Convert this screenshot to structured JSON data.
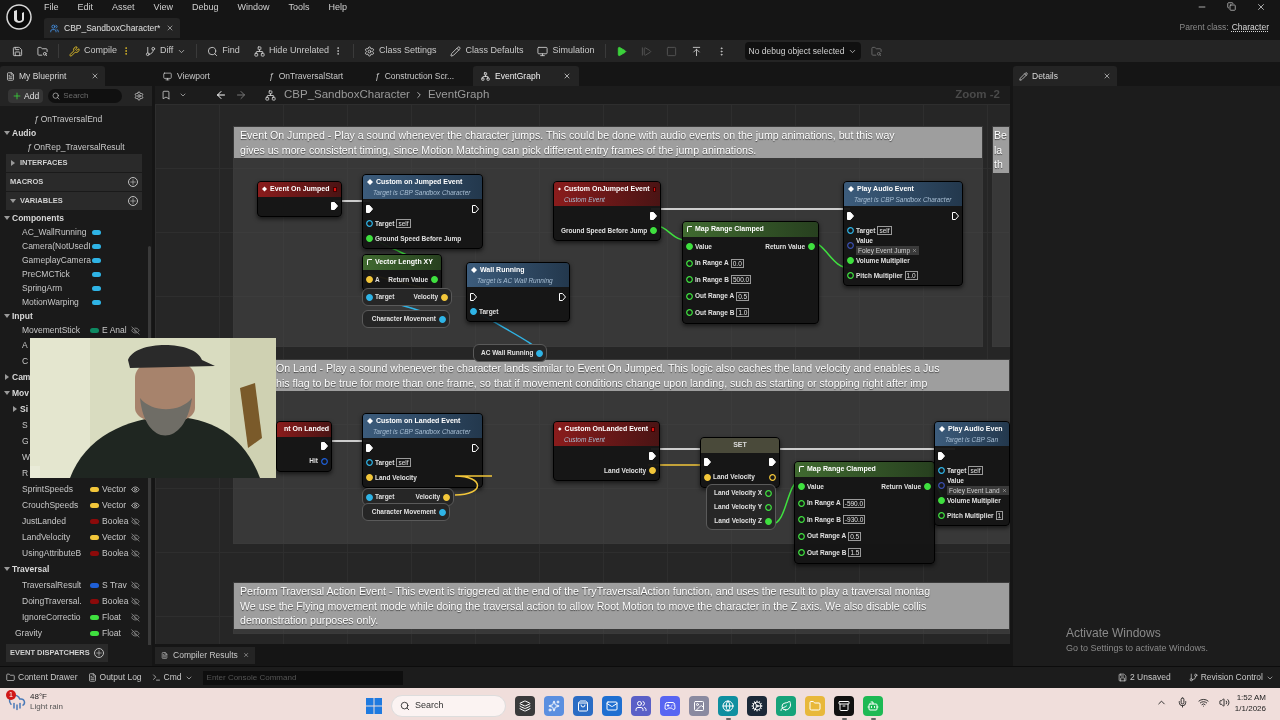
{
  "menu": [
    "File",
    "Edit",
    "Asset",
    "View",
    "Debug",
    "Window",
    "Tools",
    "Help"
  ],
  "document_tab": {
    "title": "CBP_SandboxCharacter*"
  },
  "parent_class": {
    "label": "Parent class:",
    "value": "Character"
  },
  "toolbar": [
    {
      "kind": "save",
      "disabled": false
    },
    {
      "kind": "browse",
      "disabled": false
    },
    {
      "kind": "compile",
      "label": "Compile",
      "options": true,
      "disabled": false
    },
    {
      "kind": "diff",
      "label": "Diff",
      "dropdown": true,
      "disabled": false
    },
    {
      "kind": "find",
      "label": "Find",
      "disabled": false
    },
    {
      "kind": "hide",
      "label": "Hide Unrelated",
      "options": true,
      "disabled": false
    },
    {
      "kind": "class_settings",
      "label": "Class Settings",
      "disabled": false
    },
    {
      "kind": "class_defaults",
      "label": "Class Defaults",
      "disabled": false
    },
    {
      "kind": "simulation",
      "label": "Simulation",
      "disabled": false
    },
    {
      "kind": "play",
      "disabled": false
    },
    {
      "kind": "advance",
      "disabled": true
    },
    {
      "kind": "stop",
      "disabled": true
    },
    {
      "kind": "eject",
      "disabled": false
    },
    {
      "kind": "more",
      "disabled": false
    }
  ],
  "debug_filter": {
    "value": "No debug object selected"
  },
  "my_blueprint": {
    "tab": "My Blueprint",
    "add": "Add",
    "search_placeholder": "Search",
    "tree": [
      {
        "kind": "function",
        "glyph": "ƒ",
        "name": "OnTraversalEnd"
      },
      {
        "kind": "category",
        "name": "Audio",
        "expanded": true,
        "children": [
          {
            "kind": "function",
            "glyph": "ƒ",
            "name": "OnRep_TraversalResult"
          }
        ]
      },
      {
        "kind": "section",
        "name": "INTERFACES",
        "expanded": false,
        "addable": false
      },
      {
        "kind": "section",
        "name": "MACROS",
        "addable": true
      },
      {
        "kind": "section",
        "name": "VARIABLES",
        "expanded": true,
        "addable": true,
        "children": [
          {
            "kind": "category",
            "name": "Components",
            "expanded": true,
            "children": [
              {
                "kind": "variable",
                "name": "AC_WallRunning",
                "color": "#2fb4e6"
              },
              {
                "kind": "variable",
                "name": "Camera(NotUsedI",
                "color": "#2fb4e6"
              },
              {
                "kind": "variable",
                "name": "GameplayCamera",
                "color": "#2fb4e6"
              },
              {
                "kind": "variable",
                "name": "PreCMCTick",
                "color": "#2fb4e6"
              },
              {
                "kind": "variable",
                "name": "SpringArm",
                "color": "#2fb4e6"
              },
              {
                "kind": "variable",
                "name": "MotionWarping",
                "color": "#2fb4e6"
              }
            ]
          },
          {
            "kind": "category",
            "name": "Input",
            "expanded": true,
            "children": [
              {
                "kind": "variable",
                "name": "MovementStick",
                "type": "E Anal",
                "color": "#0e8a62",
                "public": false
              },
              {
                "kind": "variable",
                "name": "A"
              },
              {
                "kind": "variable",
                "name": "C"
              }
            ]
          },
          {
            "kind": "category",
            "name": "Cam",
            "expanded": false
          },
          {
            "kind": "category",
            "name": "Mov",
            "expanded": true,
            "children": [
              {
                "kind": "category",
                "name": "Si",
                "expanded": false
              },
              {
                "kind": "variable",
                "name": "S"
              },
              {
                "kind": "variable",
                "name": "G"
              },
              {
                "kind": "variable",
                "name": "W"
              },
              {
                "kind": "variable",
                "name": "R"
              },
              {
                "kind": "variable",
                "name": "SprintSpeeds",
                "type": "Vector",
                "color": "#f2c63a",
                "public": true
              },
              {
                "kind": "variable",
                "name": "CrouchSpeeds",
                "type": "Vector",
                "color": "#f2c63a",
                "public": true
              },
              {
                "kind": "variable",
                "name": "JustLanded",
                "type": "Boolea",
                "color": "#8c0a0a",
                "public": false
              },
              {
                "kind": "variable",
                "name": "LandVelocity",
                "type": "Vector",
                "color": "#f2c63a",
                "public": false
              },
              {
                "kind": "variable",
                "name": "UsingAttributeB",
                "type": "Boolea",
                "color": "#8c0a0a",
                "public": false
              }
            ]
          },
          {
            "kind": "category",
            "name": "Traversal",
            "expanded": true,
            "children": [
              {
                "kind": "variable",
                "name": "TraversalResult",
                "type": "S Trav",
                "color": "#1f5fd6",
                "public": false
              },
              {
                "kind": "variable",
                "name": "DoingTraversal.",
                "type": "Boolea",
                "color": "#8c0a0a",
                "public": false
              },
              {
                "kind": "variable",
                "name": "IgnoreCorrectio",
                "type": "Float",
                "color": "#3fe03f",
                "public": false
              }
            ]
          },
          {
            "kind": "variable",
            "name": "Gravity",
            "type": "Float",
            "color": "#3fe03f",
            "public": false
          }
        ]
      }
    ],
    "footer": {
      "kind": "section",
      "name": "EVENT DISPATCHERS",
      "addable": true
    }
  },
  "editor_tabs": [
    {
      "kind": "viewport",
      "label": "Viewport",
      "selected": false
    },
    {
      "kind": "function",
      "glyph": "ƒ",
      "label": "OnTraversalStart",
      "selected": false
    },
    {
      "kind": "function",
      "glyph": "ƒ",
      "label": "Construction Scr...",
      "selected": false
    },
    {
      "kind": "graph",
      "label": "EventGraph",
      "selected": true
    }
  ],
  "graph": {
    "breadcrumb": [
      "CBP_SandboxCharacter",
      "EventGraph"
    ],
    "zoom": "Zoom -2",
    "comments": [
      {
        "lines": [
          "Event On Jumped - Play a sound whenever the character jumps. This could be done with audio events on the jump animations, but this way",
          "gives us more consistent timing, since Motion Matching can pick different entry frames of the jump animations."
        ]
      },
      {
        "lines": [
          "On Land - Play a sound whenever the character lands similar to Event On Jumped. This logic also caches the land velocity and enables a Jus",
          "his flag to be true for more than one frame, so that if movement conditions change upon landing, such as starting or stopping right after imp"
        ]
      },
      {
        "lines": [
          "Perform Traversal Action Event - This event is triggered at the end of the TryTraversalAction function, and uses the result to play a traversal montag",
          "We use the Flying movement mode while doing the traversal action to allow Root Motion to move the character in the Z axis. We also disable collis",
          "demonstration purposes only."
        ]
      },
      {
        "lines": [
          "Be",
          "la",
          "th"
        ]
      }
    ],
    "nodes": [
      {
        "kind": "event",
        "title": "Event On Jumped",
        "outputs": [
          {
            "kind": "exec",
            "linked": true
          }
        ]
      },
      {
        "kind": "function",
        "title": "Custom on Jumped Event",
        "subtitle": "Target is CBP Sandbox Character",
        "inputs": [
          {
            "kind": "exec",
            "linked": true
          },
          {
            "kind": "object",
            "label": "Target",
            "value": "self",
            "linked": false
          },
          {
            "kind": "float",
            "label": "Ground Speed Before Jump",
            "linked": true
          }
        ],
        "outputs": [
          {
            "kind": "exec",
            "linked": false
          }
        ]
      },
      {
        "kind": "pure",
        "title": "Vector Length XY",
        "inputs": [
          {
            "kind": "vector",
            "label": "A",
            "linked": true
          }
        ],
        "outputs": [
          {
            "kind": "float",
            "label": "Return Value",
            "linked": true
          }
        ]
      },
      {
        "kind": "getter",
        "inputs": [
          {
            "kind": "object",
            "label": "Target",
            "linked": true
          }
        ],
        "outputs": [
          {
            "kind": "vector",
            "label": "Velocity",
            "linked": true
          }
        ]
      },
      {
        "kind": "getter",
        "outputs": [
          {
            "kind": "object",
            "label": "Character Movement",
            "linked": true
          }
        ]
      },
      {
        "kind": "function",
        "title": "Wall Running",
        "subtitle": "Target is AC Wall Running",
        "inputs": [
          {
            "kind": "exec",
            "linked": false
          },
          {
            "kind": "object",
            "label": "Target",
            "linked": true
          }
        ],
        "outputs": [
          {
            "kind": "exec",
            "linked": false
          }
        ]
      },
      {
        "kind": "getter",
        "outputs": [
          {
            "kind": "object",
            "label": "AC Wall Running",
            "linked": true
          }
        ]
      },
      {
        "kind": "event",
        "title": "Custom OnJumped Event",
        "subtitle": "Custom Event",
        "outputs": [
          {
            "kind": "exec",
            "linked": true
          },
          {
            "kind": "float",
            "label": "Ground Speed Before Jump",
            "linked": true
          }
        ]
      },
      {
        "kind": "pure",
        "title": "Map Range Clamped",
        "inputs": [
          {
            "kind": "float",
            "label": "Value",
            "linked": true
          },
          {
            "kind": "float",
            "label": "In Range A",
            "value": "0.0",
            "linked": false
          },
          {
            "kind": "float",
            "label": "In Range B",
            "value": "500.0",
            "linked": false
          },
          {
            "kind": "float",
            "label": "Out Range A",
            "value": "0.5",
            "linked": false
          },
          {
            "kind": "float",
            "label": "Out Range B",
            "value": "1.0",
            "linked": false
          }
        ],
        "outputs": [
          {
            "kind": "float",
            "label": "Return Value",
            "linked": true
          }
        ]
      },
      {
        "kind": "function",
        "title": "Play Audio Event",
        "subtitle": "Target is CBP Sandbox Character",
        "inputs": [
          {
            "kind": "exec",
            "linked": true
          },
          {
            "kind": "object",
            "label": "Target",
            "value": "self",
            "linked": false
          },
          {
            "kind": "asset",
            "label": "Value",
            "value": "Foley Event Jump",
            "linked": false
          },
          {
            "kind": "float",
            "label": "Volume Multiplier",
            "linked": true
          },
          {
            "kind": "float",
            "label": "Pitch Multiplier",
            "value": "1.0",
            "linked": false
          }
        ],
        "outputs": [
          {
            "kind": "exec",
            "linked": false
          }
        ]
      },
      {
        "kind": "event",
        "title": "nt On Landed",
        "outputs": [
          {
            "kind": "exec",
            "linked": true
          },
          {
            "kind": "struct",
            "label": "Hit",
            "linked": false
          }
        ]
      },
      {
        "kind": "function",
        "title": "Custom on Landed Event",
        "subtitle": "Target is CBP Sandbox Character",
        "inputs": [
          {
            "kind": "exec",
            "linked": true
          },
          {
            "kind": "object",
            "label": "Target",
            "value": "self",
            "linked": false
          },
          {
            "kind": "vector",
            "label": "Land Velocity",
            "linked": true
          }
        ],
        "outputs": [
          {
            "kind": "exec",
            "linked": false
          }
        ]
      },
      {
        "kind": "getter",
        "inputs": [
          {
            "kind": "object",
            "label": "Target",
            "linked": true
          }
        ],
        "outputs": [
          {
            "kind": "vector",
            "label": "Velocity",
            "linked": true
          }
        ]
      },
      {
        "kind": "getter",
        "outputs": [
          {
            "kind": "object",
            "label": "Character Movement",
            "linked": true
          }
        ]
      },
      {
        "kind": "event",
        "title": "Custom OnLanded Event",
        "subtitle": "Custom Event",
        "outputs": [
          {
            "kind": "exec",
            "linked": true
          },
          {
            "kind": "vector",
            "label": "Land Velocity",
            "linked": true
          }
        ]
      },
      {
        "kind": "set",
        "title": "SET",
        "inputs": [
          {
            "kind": "exec",
            "linked": true
          },
          {
            "kind": "vector",
            "label": "Land Velocity",
            "linked": true
          }
        ],
        "outputs": [
          {
            "kind": "exec",
            "linked": true
          },
          {
            "kind": "vector",
            "linked": false
          }
        ]
      },
      {
        "kind": "getter",
        "outputs": [
          {
            "kind": "float",
            "label": "Land Velocity X",
            "linked": false
          },
          {
            "kind": "float",
            "label": "Land Velocity Y",
            "linked": false
          },
          {
            "kind": "float",
            "label": "Land Velocity Z",
            "linked": true
          }
        ]
      },
      {
        "kind": "pure",
        "title": "Map Range Clamped",
        "inputs": [
          {
            "kind": "float",
            "label": "Value",
            "linked": true
          },
          {
            "kind": "float",
            "label": "In Range A",
            "value": "-590.0",
            "linked": false
          },
          {
            "kind": "float",
            "label": "In Range B",
            "value": "-930.0",
            "linked": false
          },
          {
            "kind": "float",
            "label": "Out Range A",
            "value": "0.5",
            "linked": false
          },
          {
            "kind": "float",
            "label": "Out Range B",
            "value": "1.5",
            "linked": false
          }
        ],
        "outputs": [
          {
            "kind": "float",
            "label": "Return Value",
            "linked": true
          }
        ]
      },
      {
        "kind": "function",
        "title": "Play Audio Even",
        "subtitle": "Target is CBP San",
        "inputs": [
          {
            "kind": "exec",
            "linked": true
          },
          {
            "kind": "object",
            "label": "Target",
            "value": "self",
            "linked": false
          },
          {
            "kind": "asset",
            "label": "Value",
            "value": "Foley Event Land",
            "linked": false
          },
          {
            "kind": "float",
            "label": "Volume Multiplier",
            "linked": true
          },
          {
            "kind": "float",
            "label": "Pitch Multiplier",
            "value": "1",
            "linked": false
          }
        ]
      }
    ]
  },
  "details": {
    "tab": "Details"
  },
  "compiler_results": {
    "label": "Compiler Results"
  },
  "activation": {
    "title": "Activate Windows",
    "text": "Go to Settings to activate Windows."
  },
  "status_bar": {
    "left": [
      {
        "kind": "drawer",
        "label": "Content Drawer"
      },
      {
        "kind": "log",
        "label": "Output Log"
      },
      {
        "kind": "cmd",
        "label": "Cmd"
      }
    ],
    "console_placeholder": "Enter Console Command",
    "right": [
      {
        "kind": "unsaved",
        "label": "2 Unsaved"
      },
      {
        "kind": "revision",
        "label": "Revision Control"
      }
    ]
  },
  "taskbar": {
    "weather": {
      "temp": "48°F",
      "condition": "Light rain",
      "badge": "1"
    },
    "search_placeholder": "Search",
    "apps": [
      {
        "kind": "files",
        "running": false
      },
      {
        "kind": "copilot",
        "running": false
      },
      {
        "kind": "store",
        "running": false
      },
      {
        "kind": "mail",
        "running": false
      },
      {
        "kind": "teams",
        "running": false
      },
      {
        "kind": "discord",
        "running": false
      },
      {
        "kind": "photos",
        "running": false
      },
      {
        "kind": "edge",
        "running": true
      },
      {
        "kind": "steam",
        "running": false
      },
      {
        "kind": "leaf",
        "running": false
      },
      {
        "kind": "folder",
        "running": false
      },
      {
        "kind": "unreal",
        "running": true
      },
      {
        "kind": "bot",
        "running": true
      }
    ],
    "time": "1:52 AM",
    "date": "1/1/2026"
  }
}
